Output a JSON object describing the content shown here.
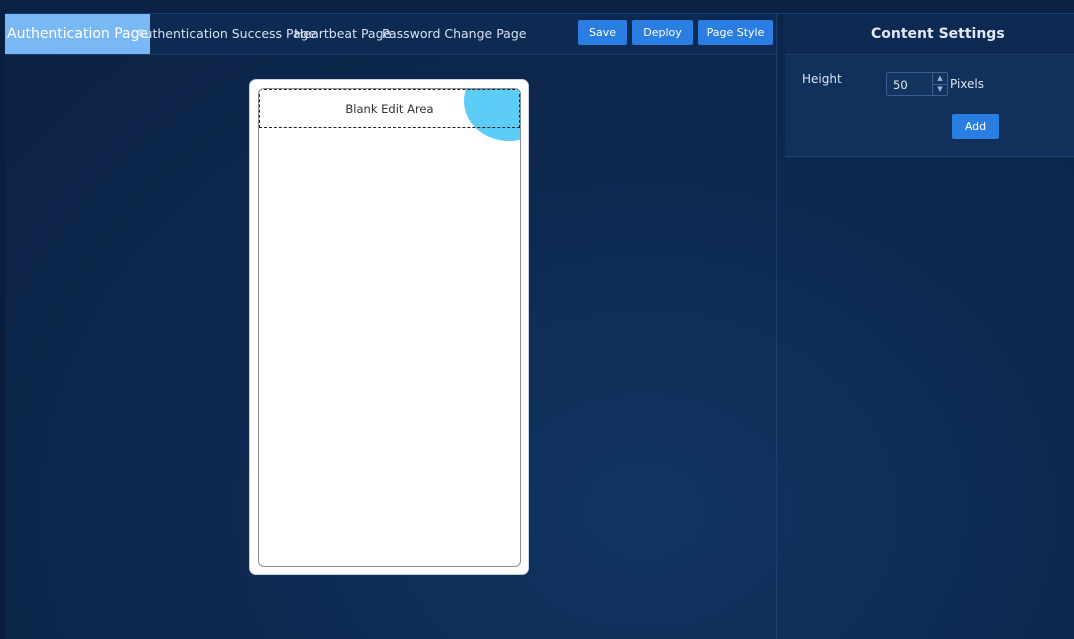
{
  "tabs": [
    {
      "label": "Authentication Page",
      "active": true
    },
    {
      "label": "Authentication Success Page",
      "active": false
    },
    {
      "label": "Heartbeat Page",
      "active": false
    },
    {
      "label": "Password Change Page",
      "active": false
    }
  ],
  "toolbar": {
    "save_label": "Save",
    "deploy_label": "Deploy",
    "page_style_label": "Page Style"
  },
  "canvas": {
    "blank_area_label": "Blank Edit Area"
  },
  "settings": {
    "title": "Content Settings",
    "height_label": "Height",
    "height_value": "50",
    "unit_label": "Pixels",
    "add_label": "Add"
  },
  "colors": {
    "background": "#0d2447",
    "active_tab": "#7ab8f5",
    "button": "#2a7de1",
    "accent_blob": "#5ccdf7"
  }
}
